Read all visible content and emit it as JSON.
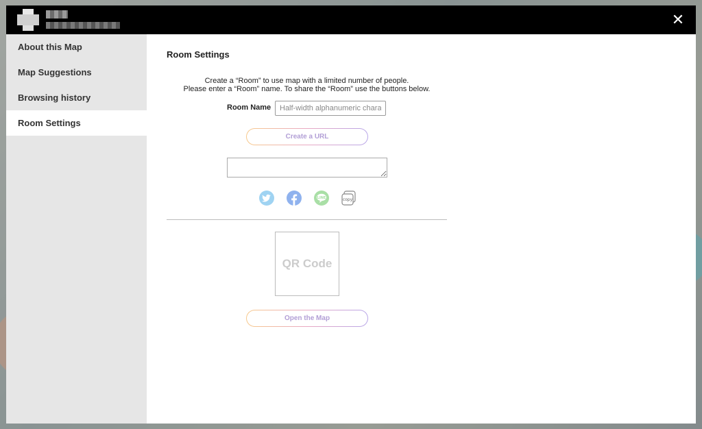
{
  "header": {
    "close_icon": "close-icon",
    "close_glyph": "✕"
  },
  "sidebar": {
    "items": [
      {
        "label": "About this Map"
      },
      {
        "label": "Map Suggestions"
      },
      {
        "label": "Browsing history"
      },
      {
        "label": "Room Settings",
        "active": true
      }
    ]
  },
  "room_settings": {
    "title": "Room Settings",
    "description_line1": "Create a “Room” to use map with a limited number of people.",
    "description_line2": "Please enter a “Room” name. To share the “Room” use the buttons below.",
    "room_name_label": "Room Name",
    "room_name_placeholder": "Half-width alphanumeric characters",
    "room_name_value": "",
    "create_url_label": "Create a URL",
    "url_value": "",
    "share_icons": [
      "twitter-icon",
      "facebook-icon",
      "line-icon",
      "copy-icon"
    ],
    "line_text": "LINE",
    "copy_text": "copy",
    "qr_placeholder": "QR Code",
    "open_map_label": "Open the Map"
  },
  "colors": {
    "header_bg": "#000000",
    "sidebar_bg": "#e6e6e6",
    "twitter": "#9fd3f2",
    "facebook": "#8fb2ee",
    "line": "#a9dfa6",
    "button_text": "#b29fd6"
  }
}
